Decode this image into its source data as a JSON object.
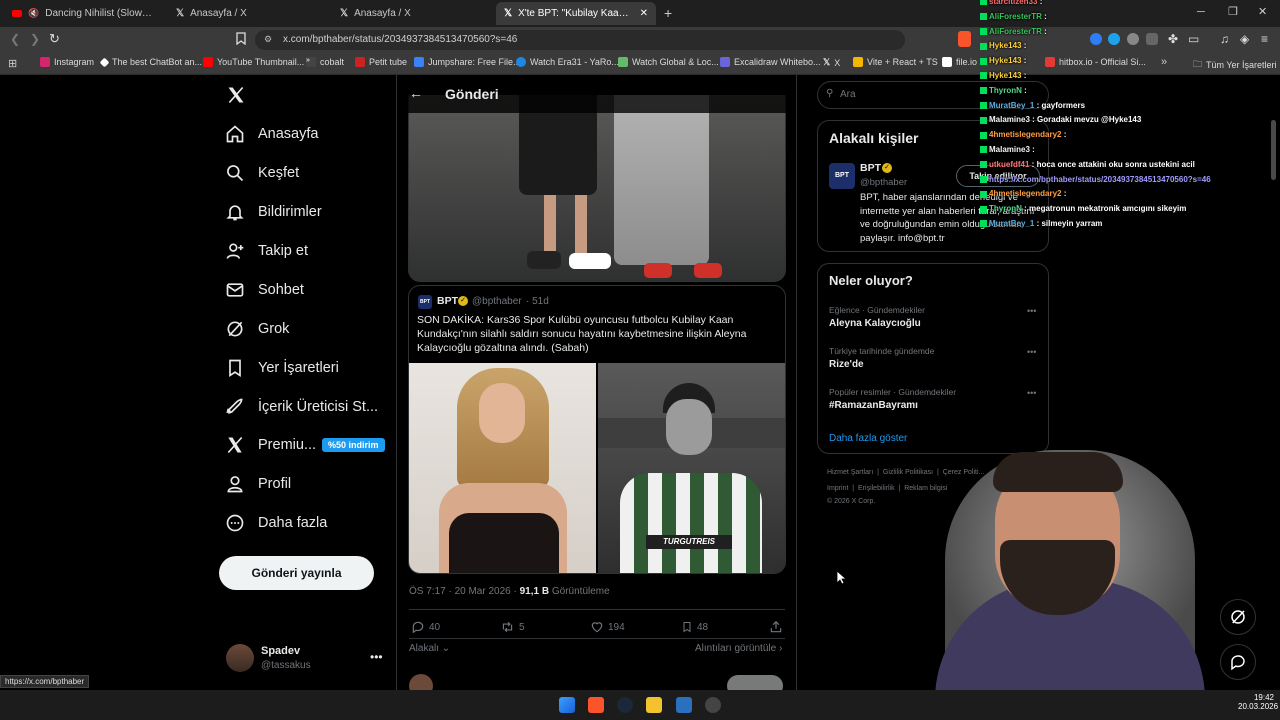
{
  "browser": {
    "tabs": [
      {
        "title": "Dancing Nihilist (Slowed Welly W",
        "icon": "youtube-icon"
      },
      {
        "title": "Anasayfa / X",
        "icon": "x-icon"
      },
      {
        "title": "Anasayfa / X",
        "icon": "x-icon"
      },
      {
        "title": "X'te BPT: \"Kubilay Kaan Kundakç",
        "icon": "x-icon",
        "active": true
      }
    ],
    "url": "x.com/bpthaber/status/2034937384513470560?s=46",
    "bookmarks": [
      {
        "label": "Instagram",
        "color": "#d6246f"
      },
      {
        "label": "The best ChatBot an...",
        "color": "#ffffff"
      },
      {
        "label": "YouTube Thumbnail...",
        "color": "#ff0000"
      },
      {
        "label": "cobalt",
        "color": "#ffffff"
      },
      {
        "label": "Petit tube",
        "color": "#cc2222"
      },
      {
        "label": "Jumpshare: Free File...",
        "color": "#3b82f6"
      },
      {
        "label": "Watch Era31 - YaRo...",
        "color": "#1e88e5"
      },
      {
        "label": "Watch Global & Loc...",
        "color": "#66bb6a"
      },
      {
        "label": "Excalidraw Whitebo...",
        "color": "#6965db"
      },
      {
        "label": "X",
        "color": "#ffffff"
      },
      {
        "label": "Vite + React + TS",
        "color": "#f5b700"
      },
      {
        "label": "file.io",
        "color": "#ffffff"
      },
      {
        "label": "hitbox.io - Official Si...",
        "color": "#e53935"
      }
    ],
    "all_bookmarks": "Tüm Yer İşaretleri",
    "status_url": "https://x.com/bpthaber"
  },
  "nav": {
    "items": [
      {
        "label": "Anasayfa",
        "icon": "home-icon"
      },
      {
        "label": "Keşfet",
        "icon": "search-icon"
      },
      {
        "label": "Bildirimler",
        "icon": "bell-icon"
      },
      {
        "label": "Takip et",
        "icon": "add-person-icon"
      },
      {
        "label": "Sohbet",
        "icon": "mail-icon"
      },
      {
        "label": "Grok",
        "icon": "grok-icon"
      },
      {
        "label": "Yer İşaretleri",
        "icon": "bookmark-icon"
      },
      {
        "label": "İçerik Üreticisi St...",
        "icon": "rocket-icon"
      },
      {
        "label": "Premiu...",
        "icon": "x-icon"
      },
      {
        "label": "Profil",
        "icon": "person-icon"
      },
      {
        "label": "Daha fazla",
        "icon": "more-circle-icon"
      }
    ],
    "premium_badge": "%50 indirim",
    "post_button": "Gönderi yayınla",
    "user": {
      "name": "Spadev",
      "handle": "@tassakus"
    }
  },
  "post": {
    "header_title": "Gönderi",
    "quoted": {
      "name": "BPT",
      "handle": "@bpthaber",
      "age": "· 51d",
      "text": "SON DAKİKA: Kars36 Spor Kulübü oyuncusu futbolcu Kubilay Kaan Kundakçı'nın silahlı saldırı sonucu hayatını kaybetmesine ilişkin Aleyna Kalaycıoğlu gözaltına alındı. (Sabah)",
      "jersey_text": "TURGUTREIS"
    },
    "meta_time": "ÖS 7:17 · 20 Mar 2026 ·",
    "meta_views": "91,1 B",
    "meta_views_label": "Görüntüleme",
    "stats": {
      "replies": "40",
      "reposts": "5",
      "likes": "194",
      "bookmarks": "48"
    },
    "related": "Alakalı",
    "quotes_link": "Alıntıları görüntüle"
  },
  "right": {
    "search_placeholder": "Ara",
    "related_people_title": "Alakalı kişiler",
    "person": {
      "name": "BPT",
      "handle": "@bpthaber",
      "follow_label": "Takip ediliyor",
      "bio": "BPT, haber ajanslarından derlediği ve internette yer alan haberleri tarar, araştırır ve doğruluğundan emin olduğu zaman paylaşır. info@bpt.tr"
    },
    "trends_title": "Neler oluyor?",
    "trends": [
      {
        "category": "Eğlence · Gündemdekiler",
        "title": "Aleyna Kalaycıoğlu"
      },
      {
        "category": "Türkiye tarihinde gündemde",
        "title": "Rize'de"
      },
      {
        "category": "Popüler resimler · Gündemdekiler",
        "title": "#RamazanBayramı"
      }
    ],
    "show_more": "Daha fazla göster",
    "footer": [
      "Hizmet Şartları",
      "Gizlilik Politikası",
      "Çerez Politi...",
      "Imprint",
      "Erişilebilirlik",
      "Reklam bilgisi"
    ],
    "copyright": "© 2026 X Corp."
  },
  "chat": [
    {
      "user": "starcitizen33",
      "msg": ":",
      "color": "#ff6b6b"
    },
    {
      "user": "AliForesterTR",
      "msg": ":",
      "color": "#35c759"
    },
    {
      "user": "AliForesterTR",
      "msg": ":",
      "color": "#35c759"
    },
    {
      "user": "Hyke143",
      "msg": ":",
      "color": "#ffd23f"
    },
    {
      "user": "Hyke143",
      "msg": ":",
      "color": "#ffd23f"
    },
    {
      "user": "Hyke143",
      "msg": ":",
      "color": "#ffd23f"
    },
    {
      "user": "ThyronN",
      "msg": ":",
      "color": "#58d68d"
    },
    {
      "user": "MuratBey_1",
      "msg": ": gayformers",
      "color": "#5dade2"
    },
    {
      "user": "Malamine3",
      "msg": ": Goradaki mevzu @Hyke143",
      "color": "#f5f5f5"
    },
    {
      "user": "4hmetislegendary2",
      "msg": ":",
      "color": "#ff9f43"
    },
    {
      "user": "Malamine3",
      "msg": ":",
      "color": "#f5f5f5"
    },
    {
      "user": "utkuefdf41",
      "msg": ": hoca once attakini oku sonra ustekini acil",
      "color": "#ff7675"
    },
    {
      "user": "",
      "msg": "https://x.com/bpthaber/status/2034937384513470560?s=46",
      "color": "#a29bfe"
    },
    {
      "user": "4hmetislegendary2",
      "msg": ":",
      "color": "#ff9f43"
    },
    {
      "user": "ThyronN",
      "msg": ": megatronun mekatronik amcıgını sikeyim",
      "color": "#58d68d"
    },
    {
      "user": "MuratBey_1",
      "msg": ": silmeyin yarram",
      "color": "#5dade2"
    }
  ],
  "taskbar": {
    "time": "19:42",
    "date": "20.03.2026"
  },
  "colors": {
    "accent": "#1d9bf0",
    "bg": "#000000",
    "border": "#2f3336",
    "muted": "#71767b"
  }
}
